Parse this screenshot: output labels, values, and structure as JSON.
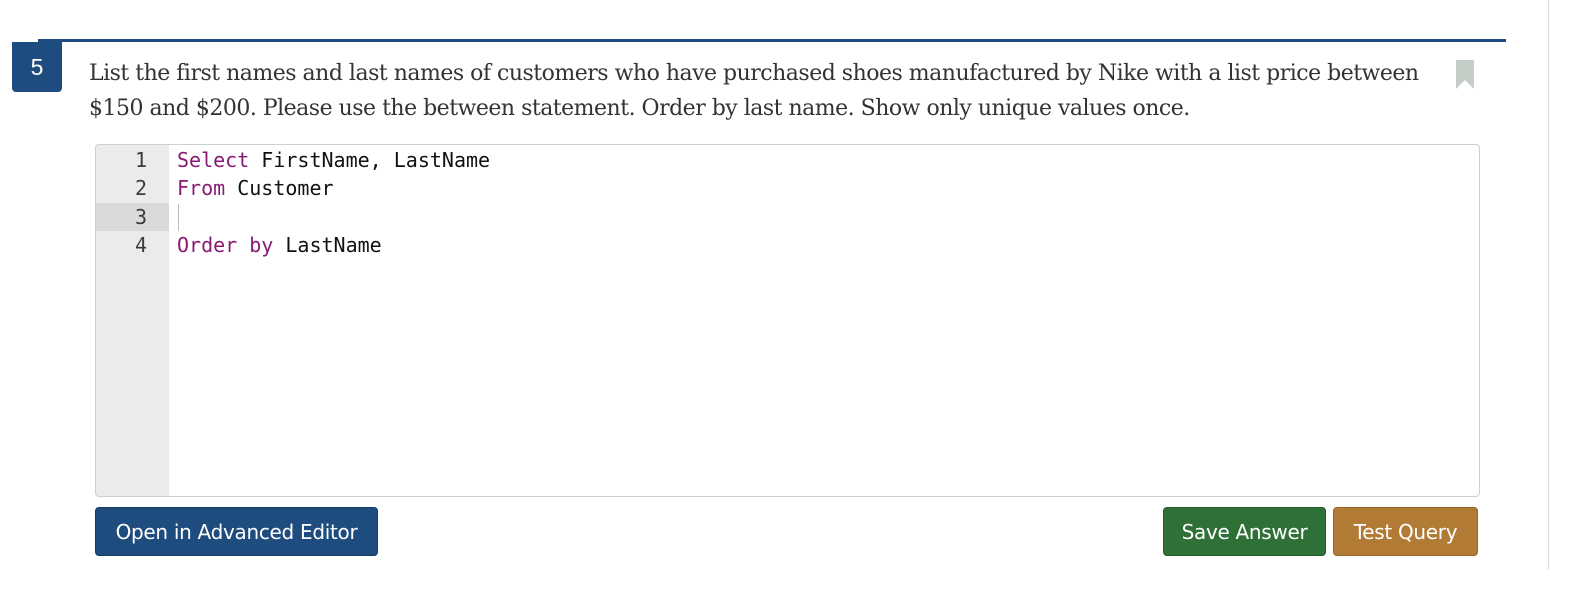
{
  "question": {
    "number": "5",
    "text": "List the first names and last names of customers who have purchased shoes manufactured by Nike with a list price between $150 and $200. Please use the between statement. Order by last name. Show only unique values once."
  },
  "editor": {
    "active_line": 3,
    "lines": [
      {
        "number": "1",
        "keyword": "Select",
        "rest": " FirstName, LastName"
      },
      {
        "number": "2",
        "keyword": "From",
        "rest": " Customer"
      },
      {
        "number": "3",
        "keyword": "",
        "rest": ""
      },
      {
        "number": "4",
        "keyword": "Order by",
        "rest": " LastName"
      }
    ]
  },
  "buttons": {
    "advanced_editor": "Open in Advanced Editor",
    "save_answer": "Save Answer",
    "test_query": "Test Query"
  },
  "colors": {
    "primary": "#1e4c7e",
    "save": "#2f7037",
    "test": "#b27b35",
    "keyword": "#8a1a73",
    "bookmark": "#c4cdc6"
  },
  "icons": {
    "bookmark": "bookmark-icon"
  }
}
